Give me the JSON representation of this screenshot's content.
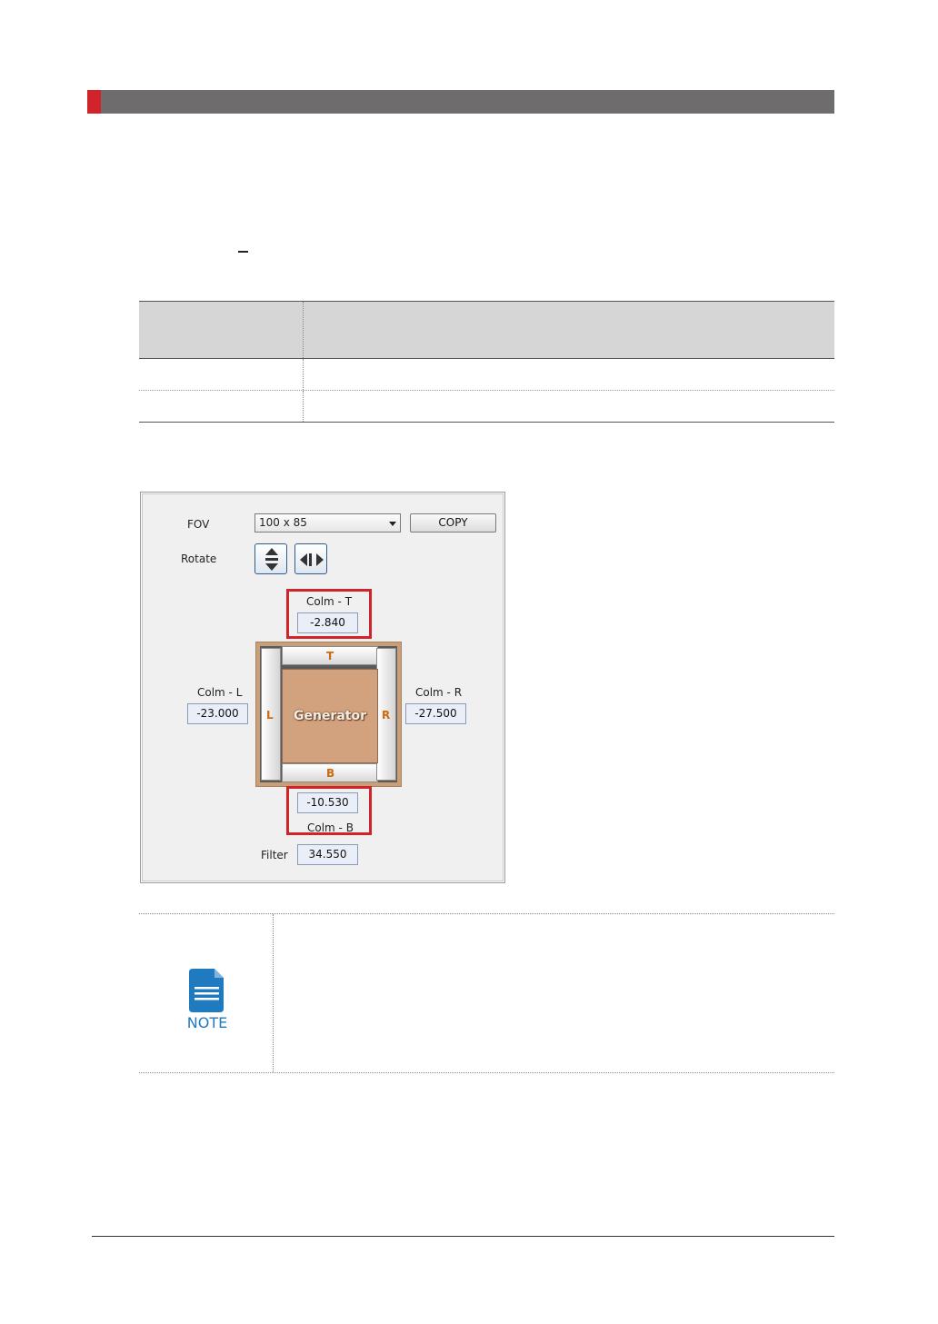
{
  "panel": {
    "fov_label": "FOV",
    "fov_value": "100 x 85",
    "copy_label": "COPY",
    "rotate_label": "Rotate",
    "colm_t_label": "Colm - T",
    "colm_t_value": "-2.840",
    "colm_l_label": "Colm - L",
    "colm_l_value": "-23.000",
    "colm_r_label": "Colm - R",
    "colm_r_value": "-27.500",
    "colm_b_label": "Colm - B",
    "colm_b_value": "-10.530",
    "filter_label": "Filter",
    "filter_value": "34.550",
    "generator_label": "Generator",
    "side_t": "T",
    "side_b": "B",
    "side_l": "L",
    "side_r": "R"
  },
  "note": {
    "label": "NOTE"
  },
  "colors": {
    "accent_red": "#d2232a",
    "header_gray": "#6e6c6d",
    "note_blue": "#1f7ac0",
    "side_orange": "#cc6a10"
  },
  "icons": [
    "rotate-vertical-icon",
    "rotate-horizontal-icon",
    "note-document-icon"
  ]
}
